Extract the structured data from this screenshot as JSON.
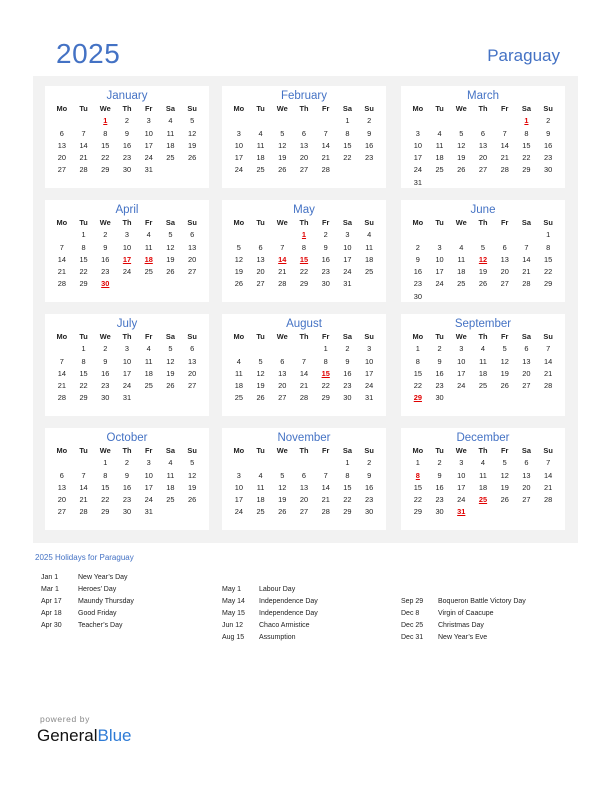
{
  "header": {
    "year": "2025",
    "country": "Paraguay"
  },
  "weekday_labels": [
    "Mo",
    "Tu",
    "We",
    "Th",
    "Fr",
    "Sa",
    "Su"
  ],
  "months": [
    {
      "name": "January",
      "offset": 2,
      "days": 31,
      "holidays": [
        1
      ]
    },
    {
      "name": "February",
      "offset": 5,
      "days": 28,
      "holidays": []
    },
    {
      "name": "March",
      "offset": 5,
      "days": 31,
      "holidays": [
        1
      ]
    },
    {
      "name": "April",
      "offset": 1,
      "days": 30,
      "holidays": [
        17,
        18,
        30
      ]
    },
    {
      "name": "May",
      "offset": 3,
      "days": 31,
      "holidays": [
        1,
        14,
        15
      ]
    },
    {
      "name": "June",
      "offset": 6,
      "days": 30,
      "holidays": [
        12
      ]
    },
    {
      "name": "July",
      "offset": 1,
      "days": 31,
      "holidays": []
    },
    {
      "name": "August",
      "offset": 4,
      "days": 31,
      "holidays": [
        15
      ]
    },
    {
      "name": "September",
      "offset": 0,
      "days": 30,
      "holidays": [
        29
      ]
    },
    {
      "name": "October",
      "offset": 2,
      "days": 31,
      "holidays": []
    },
    {
      "name": "November",
      "offset": 5,
      "days": 30,
      "holidays": []
    },
    {
      "name": "December",
      "offset": 0,
      "days": 31,
      "holidays": [
        8,
        25,
        31
      ]
    }
  ],
  "holidays_section": {
    "title": "2025 Holidays for Paraguay",
    "columns": [
      [
        {
          "date": "Jan 1",
          "name": "New Year’s Day"
        },
        {
          "date": "Mar 1",
          "name": "Heroes’ Day"
        },
        {
          "date": "Apr 17",
          "name": "Maundy Thursday"
        },
        {
          "date": "Apr 18",
          "name": "Good Friday"
        },
        {
          "date": "Apr 30",
          "name": "Teacher’s Day"
        }
      ],
      [
        {
          "date": "May 1",
          "name": "Labour Day"
        },
        {
          "date": "May 14",
          "name": "Independence Day"
        },
        {
          "date": "May 15",
          "name": "Independence Day"
        },
        {
          "date": "Jun 12",
          "name": "Chaco Armistice"
        },
        {
          "date": "Aug 15",
          "name": "Assumption"
        }
      ],
      [
        {
          "date": "Sep 29",
          "name": "Boqueron Battle Victory Day"
        },
        {
          "date": "Dec 8",
          "name": "Virgin of Caacupe"
        },
        {
          "date": "Dec 25",
          "name": "Christmas Day"
        },
        {
          "date": "Dec 31",
          "name": "New Year’s Eve"
        }
      ]
    ]
  },
  "footer": {
    "powered_by": "powered by",
    "brand_part1": "General",
    "brand_part2": "Blue"
  },
  "colors": {
    "accent": "#4472c4",
    "holiday": "#e00000",
    "panel_bg": "#f2f2f2"
  }
}
